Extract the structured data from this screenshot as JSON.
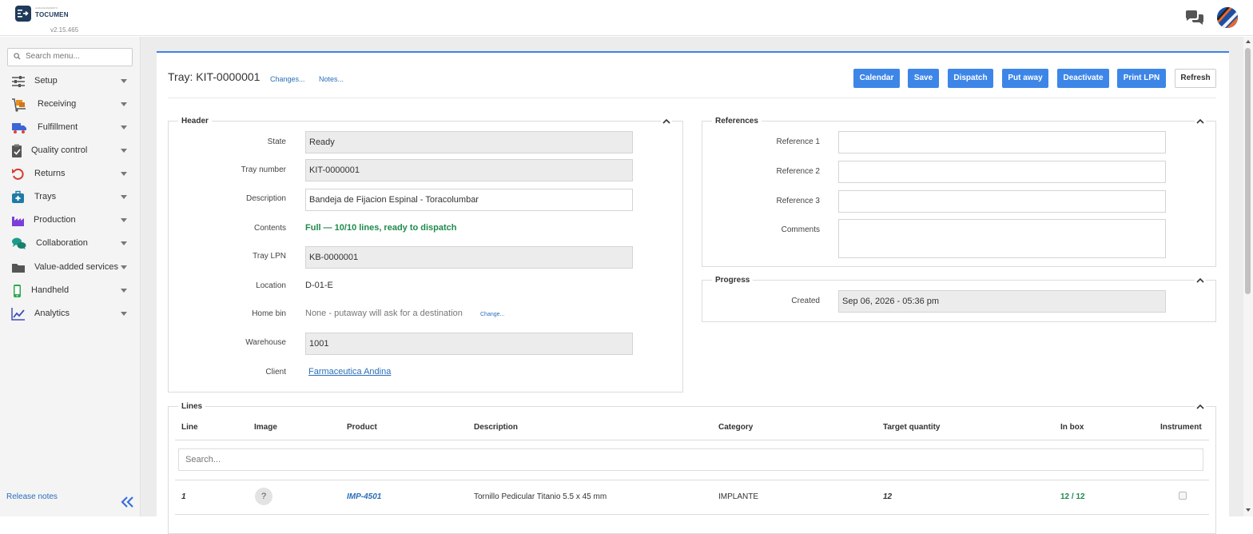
{
  "app": {
    "logo_text": "TOCUMEN",
    "logo_sup": "ALMACENAMIENTO",
    "version": "v2.15.465"
  },
  "icons": {
    "chat": "chat-bubbles-icon",
    "avatar": "user-avatar"
  },
  "sidebar": {
    "search_placeholder": "Search menu...",
    "items": [
      {
        "label": "Setup",
        "icon": "sliders-icon"
      },
      {
        "label": "Receiving",
        "icon": "dolly-icon"
      },
      {
        "label": "Fulfillment",
        "icon": "truck-icon"
      },
      {
        "label": "Quality control",
        "icon": "clipboard-check-icon"
      },
      {
        "label": "Returns",
        "icon": "undo-icon"
      },
      {
        "label": "Trays",
        "icon": "medical-kit-icon"
      },
      {
        "label": "Production",
        "icon": "factory-icon"
      },
      {
        "label": "Collaboration",
        "icon": "comments-icon"
      },
      {
        "label": "Value-added services",
        "icon": "folder-icon"
      },
      {
        "label": "Handheld",
        "icon": "mobile-icon"
      },
      {
        "label": "Analytics",
        "icon": "line-chart-icon"
      }
    ],
    "release_notes": "Release notes"
  },
  "page": {
    "title_prefix": "Tray: ",
    "title_id": "KIT-0000001",
    "changes_link": "Changes...",
    "notes_link": "Notes...",
    "buttons": {
      "calendar": "Calendar",
      "save": "Save",
      "dispatch": "Dispatch",
      "put_away": "Put away",
      "deactivate": "Deactivate",
      "print_lpn": "Print LPN",
      "refresh": "Refresh"
    }
  },
  "header_section": {
    "legend": "Header",
    "state_label": "State",
    "state_value": "Ready",
    "tray_number_label": "Tray number",
    "tray_number_value": "KIT-0000001",
    "description_label": "Description",
    "description_value": "Bandeja de Fijacion Espinal - Toracolumbar",
    "contents_label": "Contents",
    "contents_value": "Full — 10/10 lines, ready to dispatch",
    "tray_lpn_label": "Tray LPN",
    "tray_lpn_value": "KB-0000001",
    "location_label": "Location",
    "location_value": "D-01-E",
    "home_bin_label": "Home bin",
    "home_bin_value": "None - putaway will ask for a destination",
    "home_bin_change": "Change...",
    "warehouse_label": "Warehouse",
    "warehouse_value": "1001",
    "client_label": "Client",
    "client_value": "Farmaceutica Andina"
  },
  "references_section": {
    "legend": "References",
    "ref1_label": "Reference 1",
    "ref1_value": "",
    "ref2_label": "Reference 2",
    "ref2_value": "",
    "ref3_label": "Reference 3",
    "ref3_value": "",
    "comments_label": "Comments",
    "comments_value": ""
  },
  "progress_section": {
    "legend": "Progress",
    "created_label": "Created",
    "created_value": "Sep 06, 2026 - 05:36 pm"
  },
  "lines_section": {
    "legend": "Lines",
    "columns": [
      "Line",
      "Image",
      "Product",
      "Description",
      "Category",
      "Target quantity",
      "In box",
      "Instrument"
    ],
    "search_placeholder": "Search...",
    "rows": [
      {
        "line": "1",
        "image": "?",
        "product": "IMP-4501",
        "description": "Tornillo Pedicular Titanio 5.5 x 45 mm",
        "category": "IMPLANTE",
        "target_quantity": "12",
        "in_box": "12 / 12",
        "instrument": false
      }
    ]
  },
  "colors": {
    "primary": "#3d86e8",
    "success": "#1f8a4c",
    "link": "#2a6ebb"
  }
}
